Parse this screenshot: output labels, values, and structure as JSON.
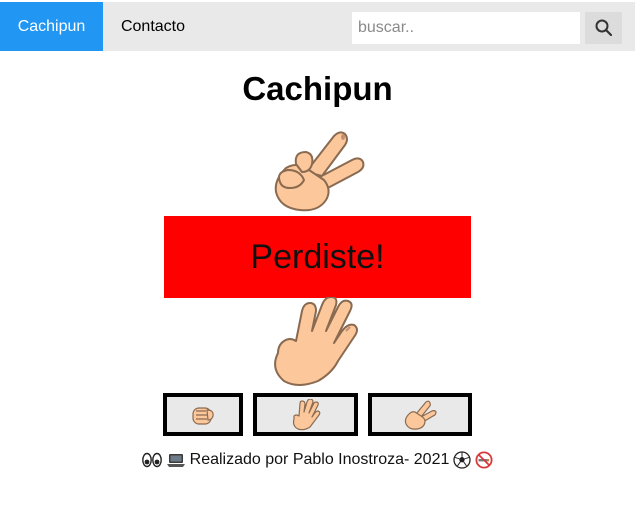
{
  "nav": {
    "brand": "Cachipun",
    "contact": "Contacto",
    "search_placeholder": "buscar.."
  },
  "main": {
    "title": "Cachipun",
    "result": "Perdiste!",
    "computer_hand": "scissors",
    "player_hand": "paper",
    "choices": [
      "rock",
      "paper",
      "scissors"
    ]
  },
  "footer": {
    "text": "Realizado por Pablo Inostroza- 2021",
    "icons": [
      "eyes-icon",
      "laptop-icon",
      "soccer-ball-icon",
      "no-smoking-icon"
    ]
  },
  "colors": {
    "nav_bg": "#e9e9e9",
    "active_tab": "#2196F3",
    "result_bg": "#ff0000",
    "skin": "#fcc89b"
  }
}
